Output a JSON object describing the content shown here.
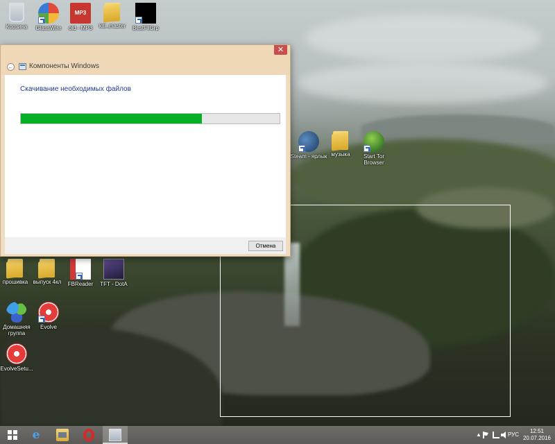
{
  "desktop": {
    "icons": [
      {
        "label": "Корзина"
      },
      {
        "label": "GlassWire"
      },
      {
        "label": "old - MP3",
        "badge": "MP3"
      },
      {
        "label": "kill_master"
      },
      {
        "label": "BestFilGrp"
      },
      {
        "label": "Steam - ярлык"
      },
      {
        "label": "музыка"
      },
      {
        "label": "Start Tor Browser"
      },
      {
        "label": "прошивка"
      },
      {
        "label": "выпуск 4кл"
      },
      {
        "label": "FBReader"
      },
      {
        "label": "TFT - DotA"
      },
      {
        "label": "Домашняя группа"
      },
      {
        "label": "Evolve"
      },
      {
        "label": "EvolveSetu..."
      }
    ]
  },
  "dialog": {
    "title": "Компоненты Windows",
    "heading": "Скачивание необходимых файлов",
    "progress": 0.7,
    "cancel_label": "Отмена",
    "close_glyph": "✕",
    "back_glyph": "←"
  },
  "taskbar": {
    "lang": "РУС",
    "time": "12:51",
    "date": "20.07.2016",
    "ie_glyph": "e",
    "tray_up_glyph": "▲",
    "apps": [
      "internet-explorer",
      "file-explorer",
      "opera",
      "windows-components"
    ]
  },
  "colors": {
    "progress_fill": "#06b025",
    "close_button": "#c74f4f",
    "heading_text": "#1e3c8c"
  }
}
